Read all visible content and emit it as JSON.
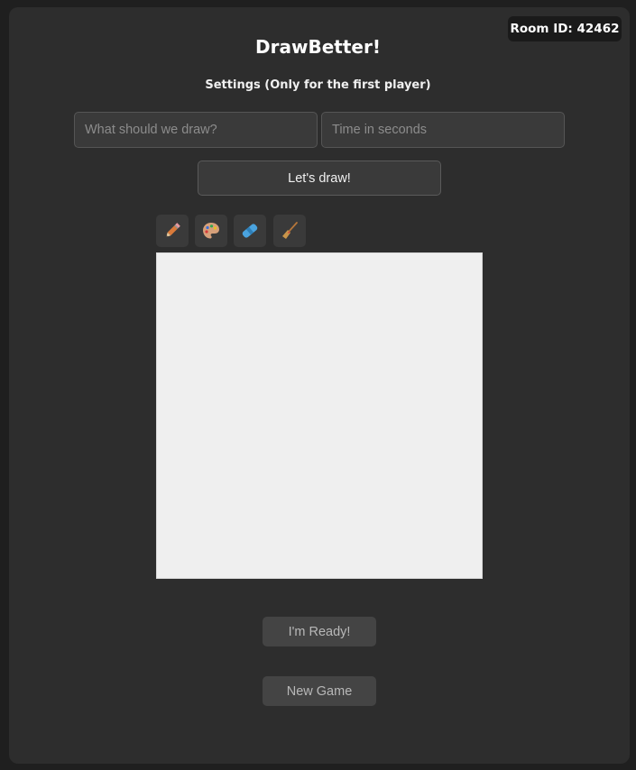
{
  "room": {
    "label": "Room ID: 42462"
  },
  "header": {
    "title": "DrawBetter!"
  },
  "settings": {
    "label": "Settings (Only for the first player)",
    "draw_placeholder": "What should we draw?",
    "time_placeholder": "Time in seconds",
    "start_label": "Let's draw!"
  },
  "tools": [
    {
      "name": "pencil-icon"
    },
    {
      "name": "palette-icon"
    },
    {
      "name": "eraser-icon"
    },
    {
      "name": "broom-icon"
    }
  ],
  "actions": {
    "ready_label": "I'm Ready!",
    "new_game_label": "New Game"
  },
  "colors": {
    "panel": "#2d2d2d",
    "canvas": "#efefef",
    "button": "#444444"
  }
}
